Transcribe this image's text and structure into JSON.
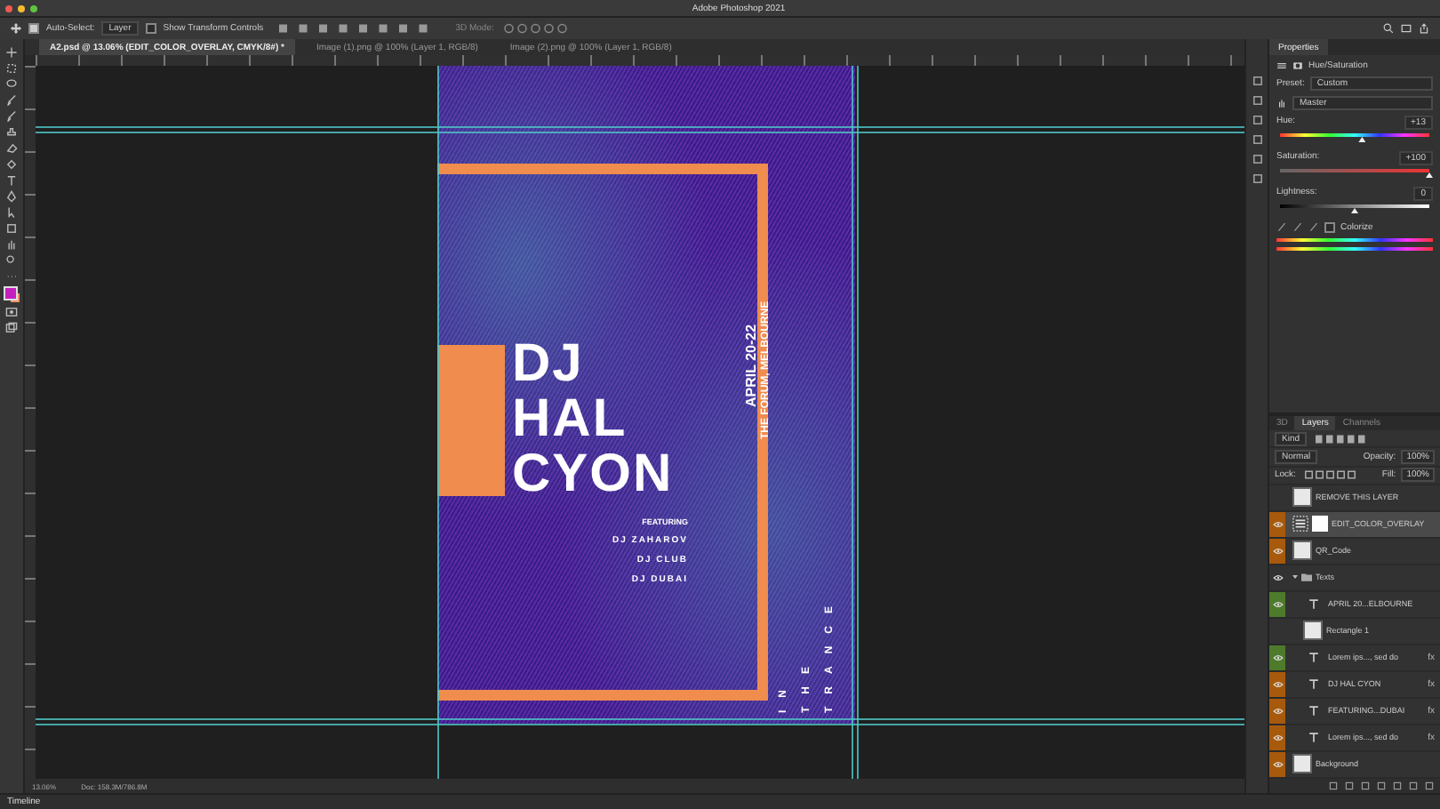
{
  "window": {
    "title": "Adobe Photoshop 2021"
  },
  "options_bar": {
    "auto_select": {
      "label": "Auto-Select:",
      "checked": true
    },
    "target": "Layer",
    "transform_controls": {
      "label": "Show Transform Controls",
      "checked": false
    },
    "mode_label": "3D Mode:"
  },
  "tabs": [
    {
      "label": "A2.psd @ 13.06% (EDIT_COLOR_OVERLAY, CMYK/8#) *",
      "selected": true
    },
    {
      "label": "Image (1).png @ 100% (Layer 1, RGB/8)",
      "selected": false
    },
    {
      "label": "Image (2).png @ 100% (Layer 1, RGB/8)",
      "selected": false
    }
  ],
  "poster": {
    "title_lines": [
      "DJ",
      "HAL",
      "CYON"
    ],
    "featuring": "FEATURING",
    "artists": [
      "DJ ZAHAROV",
      "DJ CLUB",
      "DJ DUBAI"
    ],
    "date": "APRIL 20-22",
    "venue": "THE FORUM, MELBOURNE",
    "tagline": [
      "IN",
      "THE",
      "TRANCE"
    ]
  },
  "properties": {
    "title": "Properties",
    "adjustment": "Hue/Saturation",
    "preset_label": "Preset:",
    "preset": "Custom",
    "channel": "Master",
    "sliders": [
      {
        "label": "Hue:",
        "reading": "+13",
        "level": 0.55,
        "kind": "hue"
      },
      {
        "label": "Saturation:",
        "reading": "+100",
        "level": 1.0,
        "kind": "saturation"
      },
      {
        "label": "Lightness:",
        "reading": "0",
        "level": 0.5,
        "kind": "lightness"
      }
    ],
    "colorize": {
      "label": "Colorize",
      "checked": false
    }
  },
  "layers": {
    "tabs": [
      {
        "label": "3D",
        "selected": false
      },
      {
        "label": "Layers",
        "selected": true
      },
      {
        "label": "Channels",
        "selected": false
      }
    ],
    "filter": "Kind",
    "blend_mode": "Normal",
    "opacity_label": "Opacity:",
    "opacity": "100%",
    "lock_label": "Lock:",
    "fill_label": "Fill:",
    "fill": "100%",
    "items": [
      {
        "name": "REMOVE THIS LAYER",
        "kind": "image",
        "visible": false,
        "selected": false
      },
      {
        "name": "EDIT_COLOR_OVERLAY",
        "kind": "adjustment",
        "visible": true,
        "selected": true,
        "color": "#a85a0c"
      },
      {
        "name": "QR_Code",
        "kind": "image",
        "visible": true,
        "selected": false,
        "color": "#a85a0c"
      },
      {
        "name": "Texts",
        "kind": "group",
        "visible": true,
        "selected": false,
        "expanded": true,
        "children": [
          {
            "name": "APRIL 20...ELBOURNE",
            "kind": "text",
            "visible": true,
            "selected": false,
            "color": "#4e7a2c"
          },
          {
            "name": "Rectangle 1",
            "kind": "image",
            "visible": false,
            "selected": false
          },
          {
            "name": "Lorem ips..., sed do",
            "kind": "text",
            "visible": true,
            "selected": false,
            "effects": "fx",
            "color": "#4e7a2c"
          },
          {
            "name": "DJ HAL CYON",
            "kind": "text",
            "visible": true,
            "selected": false,
            "effects": "fx",
            "color": "#a85a0c"
          },
          {
            "name": "FEATURING...DUBAI",
            "kind": "text",
            "visible": true,
            "selected": false,
            "effects": "fx",
            "color": "#a85a0c"
          },
          {
            "name": "Lorem ips..., sed do",
            "kind": "text",
            "visible": true,
            "selected": false,
            "effects": "fx",
            "color": "#a85a0c"
          }
        ]
      },
      {
        "name": "Background",
        "kind": "image",
        "visible": true,
        "selected": false,
        "color": "#a85a0c"
      }
    ]
  },
  "status_bar": {
    "zoom": "13.06%",
    "doc": "Doc: 158.3M/786.8M"
  },
  "timeline": {
    "label": "Timeline"
  }
}
